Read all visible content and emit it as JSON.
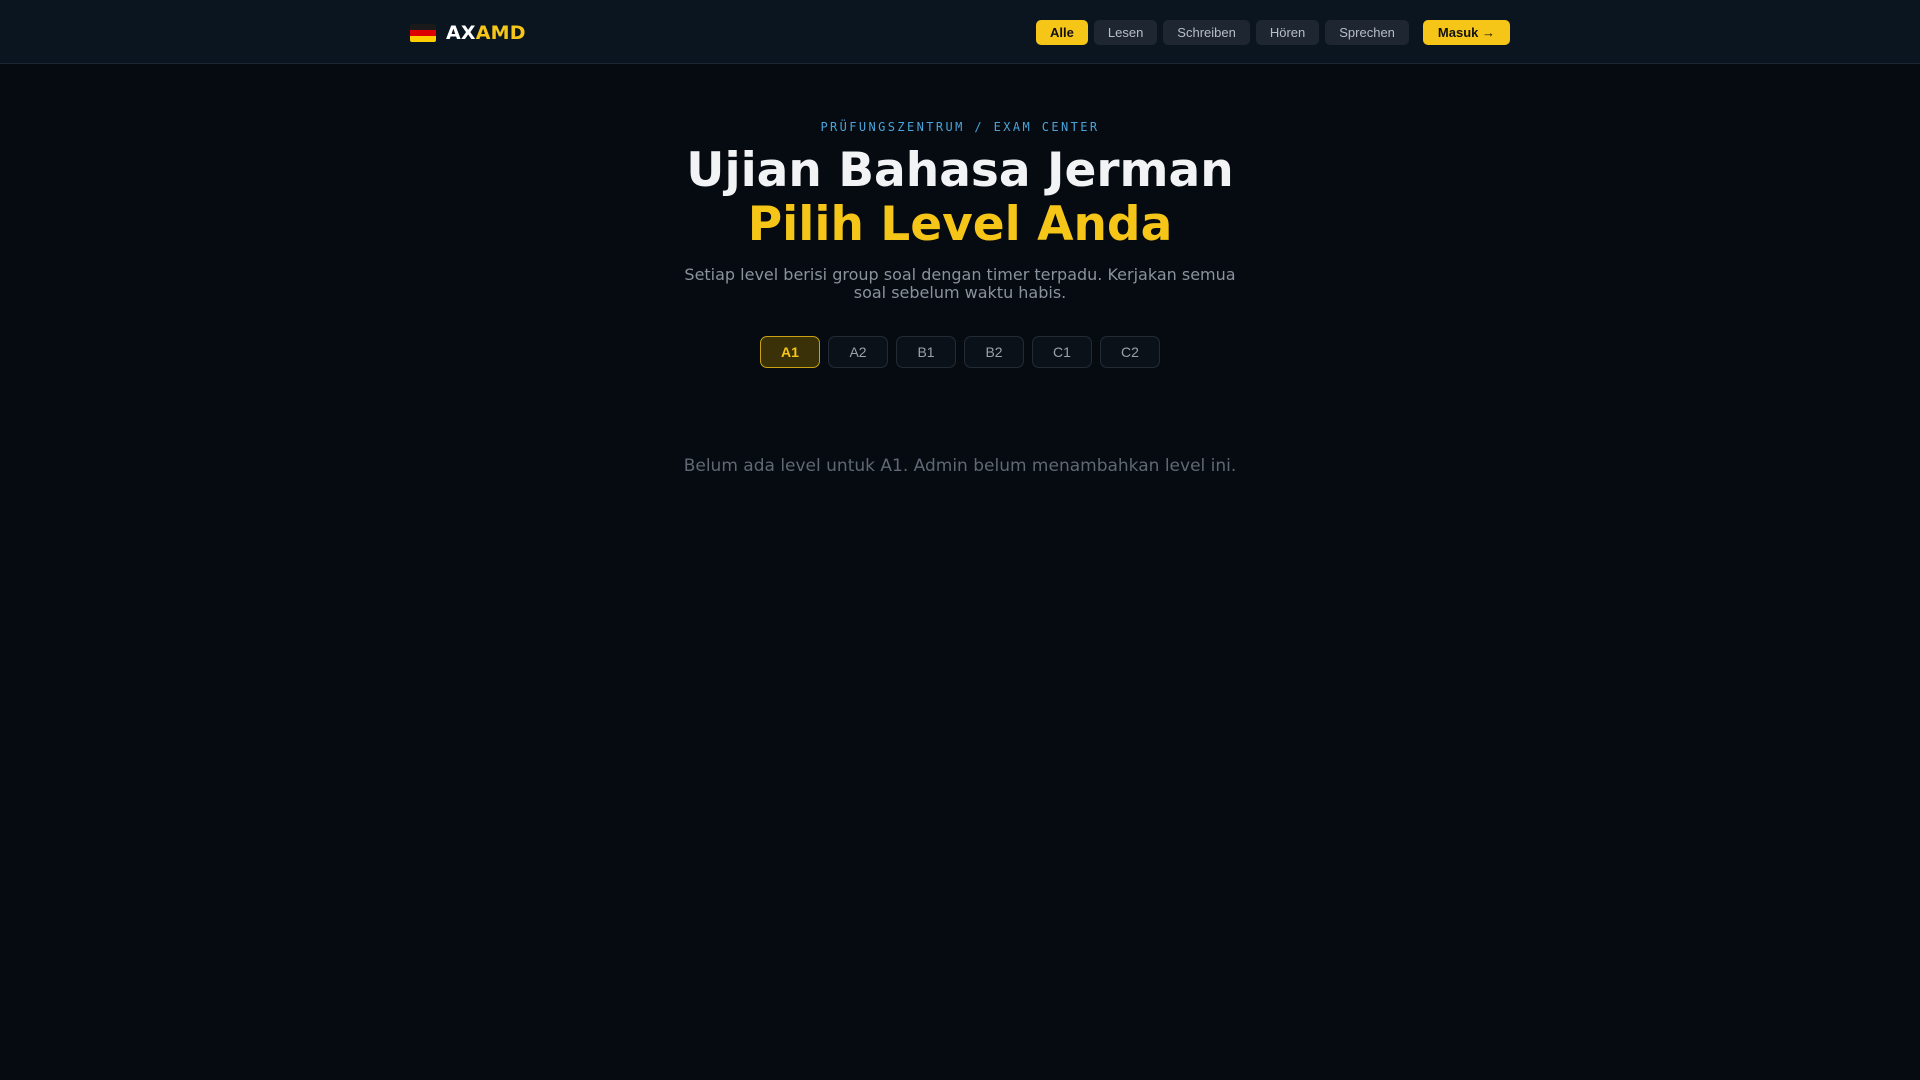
{
  "brand": {
    "flag_icon": "german-flag-icon",
    "name_part1": "AX",
    "name_part2": "AMD"
  },
  "nav": {
    "filters": [
      {
        "label": "Alle",
        "active": true
      },
      {
        "label": "Lesen",
        "active": false
      },
      {
        "label": "Schreiben",
        "active": false
      },
      {
        "label": "Hören",
        "active": false
      },
      {
        "label": "Sprechen",
        "active": false
      }
    ],
    "login_label": "Masuk →"
  },
  "hero": {
    "eyebrow": "PRÜFUNGSZENTRUM / EXAM CENTER",
    "title_line1": "Ujian Bahasa Jerman",
    "title_line2": "Pilih Level Anda",
    "subtitle": "Setiap level berisi group soal dengan timer terpadu. Kerjakan semua soal sebelum waktu habis."
  },
  "levels": [
    {
      "label": "A1",
      "active": true
    },
    {
      "label": "A2",
      "active": false
    },
    {
      "label": "B1",
      "active": false
    },
    {
      "label": "B2",
      "active": false
    },
    {
      "label": "C1",
      "active": false
    },
    {
      "label": "C2",
      "active": false
    }
  ],
  "empty_message": "Belum ada level untuk A1. Admin belum menambahkan level ini.",
  "colors": {
    "accent": "#f5c518",
    "background": "#060a11",
    "topbar": "#0b1520",
    "eyebrow": "#4aa3d8"
  }
}
